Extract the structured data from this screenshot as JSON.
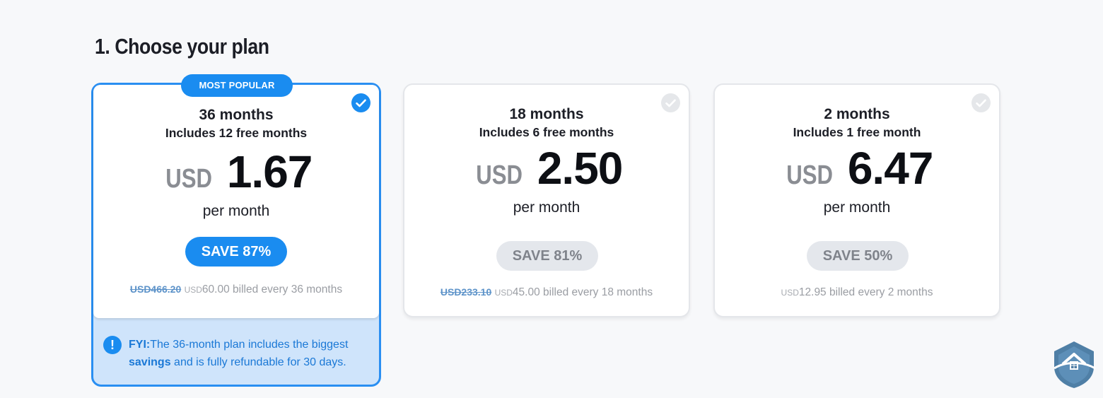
{
  "heading": "1. Choose your plan",
  "plans": [
    {
      "badge": "MOST POPULAR",
      "term": "36 months",
      "free": "Includes 12 free months",
      "currency": "USD",
      "amount": "1.67",
      "per": "per month",
      "save": "SAVE 87%",
      "old_price": "USD466.20",
      "billed_currency": "USD",
      "billed_amount": "60.00 billed every 36 months",
      "selected": true
    },
    {
      "term": "18 months",
      "free": "Includes 6 free months",
      "currency": "USD",
      "amount": "2.50",
      "per": "per month",
      "save": "SAVE 81%",
      "old_price": "USD233.10",
      "billed_currency": "USD",
      "billed_amount": "45.00 billed every 18 months",
      "selected": false
    },
    {
      "term": "2 months",
      "free": "Includes 1 free month",
      "currency": "USD",
      "amount": "6.47",
      "per": "per month",
      "save": "SAVE 50%",
      "billed_currency": "USD",
      "billed_amount": "12.95 billed every 2 months",
      "selected": false
    }
  ],
  "fyi": {
    "label": "FYI:",
    "text_1": "The 36-month plan includes the biggest",
    "bold": "savings",
    "text_2": " and is fully refundable for 30 days."
  },
  "icons": {
    "check": "checkmark-icon",
    "info": "exclamation-icon",
    "logo": "home-shield-logo"
  },
  "colors": {
    "accent": "#1a8cf0",
    "selected_bg": "#cfe4fb",
    "muted_badge": "#e4e7ec"
  }
}
